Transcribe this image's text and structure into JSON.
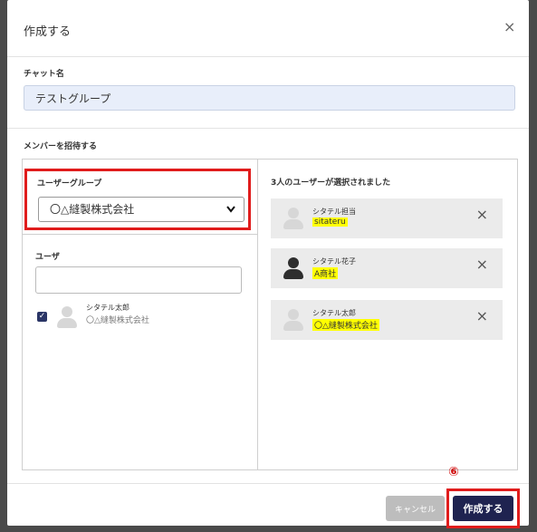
{
  "dialog": {
    "title": "作成する",
    "close_icon": "×"
  },
  "chat_name": {
    "label": "チャット名",
    "value": "テストグループ"
  },
  "invite": {
    "label": "メンバーを招待する"
  },
  "user_group": {
    "label": "ユーザーグループ",
    "selected": "〇△縫製株式会社",
    "chevron_icon": "chevron-down-icon"
  },
  "user_search": {
    "label": "ユーザ",
    "value": ""
  },
  "candidates": [
    {
      "name": "シタテル太郎",
      "org": "〇△縫製株式会社",
      "checked": true,
      "avatar": "light"
    }
  ],
  "selected": {
    "title": "3人のユーザーが選択されました",
    "users": [
      {
        "name": "シタテル担当",
        "org": "sitateru",
        "avatar": "light"
      },
      {
        "name": "シタテル花子",
        "org": "A商社",
        "avatar": "dark"
      },
      {
        "name": "シタテル太郎",
        "org": "〇△縫製株式会社",
        "avatar": "light"
      }
    ],
    "remove_icon": "×"
  },
  "footer": {
    "step_badge": "⑥",
    "cancel_label": "キャンセル",
    "create_label": "作成する"
  },
  "colors": {
    "primary": "#1f2350",
    "highlight_border": "#e01c1c",
    "input_bg": "#e8eefa",
    "marker": "#ffff00"
  }
}
